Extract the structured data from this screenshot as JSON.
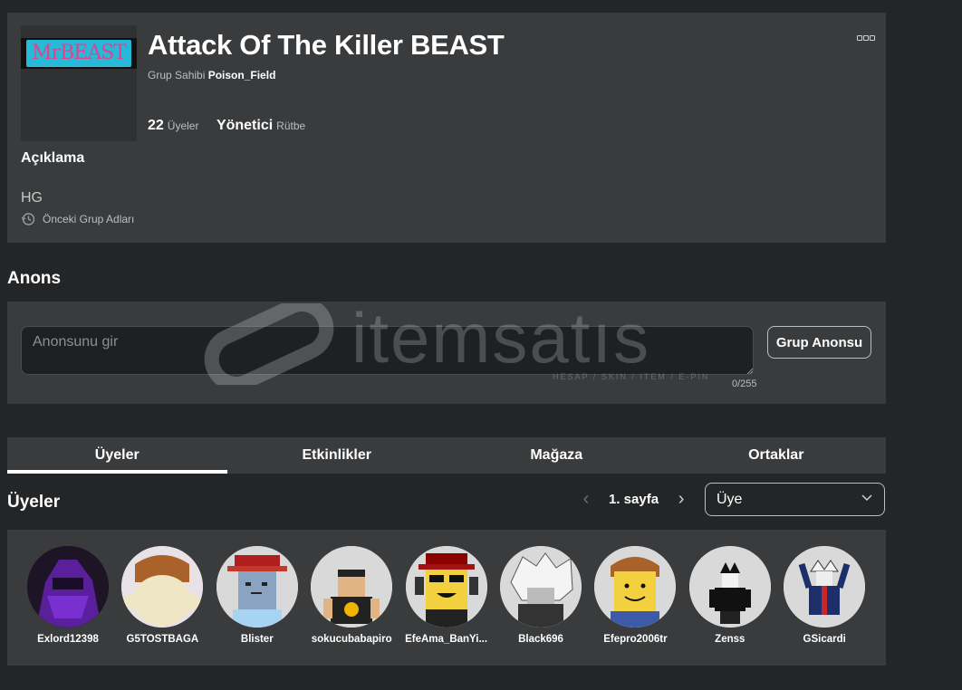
{
  "group": {
    "logo_text": "MrBEAST",
    "title": "Attack Of The Killer BEAST",
    "owner_label": "Grup Sahibi",
    "owner_name": "Poison_Field",
    "members_count": "22",
    "members_label": "Üyeler",
    "rank_value": "Yönetici",
    "rank_label": "Rütbe",
    "description_heading": "Açıklama",
    "description": "HG",
    "previous_names_label": "Önceki Grup Adları"
  },
  "announcement": {
    "title": "Anons",
    "placeholder": "Anonsunu gir",
    "char_count": "0/255",
    "button_label": "Grup Anonsu"
  },
  "watermark": {
    "text": "itemsatıs",
    "subtext": "HESAP / SKIN / ITEM / E-PIN"
  },
  "tabs": [
    {
      "label": "Üyeler",
      "active": true
    },
    {
      "label": "Etkinlikler",
      "active": false
    },
    {
      "label": "Mağaza",
      "active": false
    },
    {
      "label": "Ortaklar",
      "active": false
    }
  ],
  "members_section": {
    "title": "Üyeler",
    "page_label": "1. sayfa",
    "role_selected": "Üye"
  },
  "members": [
    {
      "name": "Exlord12398",
      "icon": "avatar-exlord",
      "bg": "#1d1426"
    },
    {
      "name": "G5TOSTBAGA",
      "icon": "avatar-gstostbaga",
      "bg": "#e8e1e6"
    },
    {
      "name": "Blister",
      "icon": "avatar-blister",
      "bg": "#d9d9d9"
    },
    {
      "name": "sokucubabapiro",
      "icon": "avatar-sokucu",
      "bg": "#d9d9d9"
    },
    {
      "name": "EfeAma_BanYi...",
      "icon": "avatar-efeama",
      "bg": "#d9d9d9"
    },
    {
      "name": "Black696",
      "icon": "avatar-black696",
      "bg": "#d9d9d9"
    },
    {
      "name": "Efepro2006tr",
      "icon": "avatar-efepro",
      "bg": "#d9d9d9"
    },
    {
      "name": "Zenss",
      "icon": "avatar-zenss",
      "bg": "#d9d9d9"
    },
    {
      "name": "GSicardi",
      "icon": "avatar-gsicardi",
      "bg": "#d9d9d9"
    }
  ]
}
